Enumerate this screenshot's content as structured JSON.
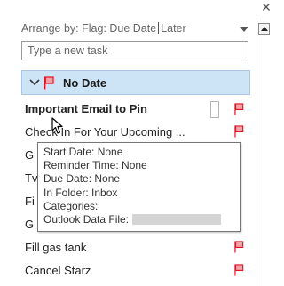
{
  "window": {
    "close_glyph": "✕"
  },
  "arrange": {
    "prefix": "Arrange by: Flag: Due Date",
    "order": "Later",
    "caret_icon": "chevron-down-icon"
  },
  "new_task": {
    "placeholder": "Type a new task"
  },
  "group": {
    "label": "No Date",
    "chevron_glyph": "⌄",
    "flag_color": "#e81123"
  },
  "tasks": [
    {
      "title": "Important Email to Pin",
      "bold": true,
      "flagged": true
    },
    {
      "title": "Check In For Your Upcoming ...",
      "bold": false,
      "flagged": true
    },
    {
      "title": "G",
      "bold": false,
      "flagged": false
    },
    {
      "title": "Tv",
      "bold": false,
      "flagged": false
    },
    {
      "title": "Fi",
      "bold": false,
      "flagged": false
    },
    {
      "title": "G",
      "bold": false,
      "flagged": false
    },
    {
      "title": "Fill gas tank",
      "bold": false,
      "flagged": true
    },
    {
      "title": "Cancel Starz",
      "bold": false,
      "flagged": true
    }
  ],
  "tooltip": {
    "start_date": "Start Date: None",
    "reminder_time": "Reminder Time: None",
    "due_date": "Due Date: None",
    "in_folder": "In Folder: Inbox",
    "categories": "Categories:",
    "data_file": "Outlook Data File:"
  }
}
